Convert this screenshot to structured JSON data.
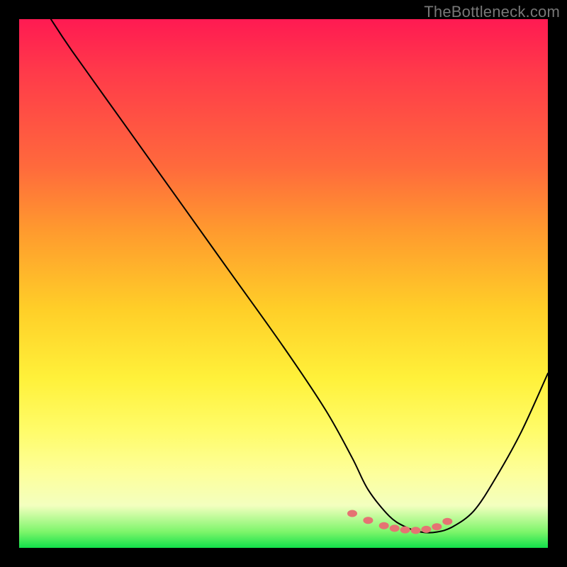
{
  "watermark": "TheBottleneck.com",
  "chart_data": {
    "type": "line",
    "title": "",
    "xlabel": "",
    "ylabel": "",
    "xlim": [
      0,
      100
    ],
    "ylim": [
      0,
      100
    ],
    "grid": false,
    "series": [
      {
        "name": "bottleneck-curve",
        "x": [
          6,
          10,
          20,
          30,
          40,
          50,
          58,
          63,
          66,
          70,
          73,
          76,
          79,
          82,
          86,
          90,
          95,
          100
        ],
        "values": [
          100,
          94,
          80,
          66,
          52,
          38,
          26,
          17,
          11,
          6,
          4,
          3,
          3,
          4,
          7,
          13,
          22,
          33
        ]
      }
    ],
    "markers": {
      "name": "highlight-band",
      "x": [
        63,
        66,
        69,
        71,
        73,
        75,
        77,
        79,
        81
      ],
      "values": [
        6.5,
        5.2,
        4.2,
        3.7,
        3.4,
        3.3,
        3.5,
        4.0,
        5.0
      ]
    },
    "colors": {
      "gradient_top": "#ff1a52",
      "gradient_mid": "#fff13a",
      "gradient_bottom": "#12e04a",
      "curve": "#000000",
      "marker": "#e57373"
    }
  }
}
